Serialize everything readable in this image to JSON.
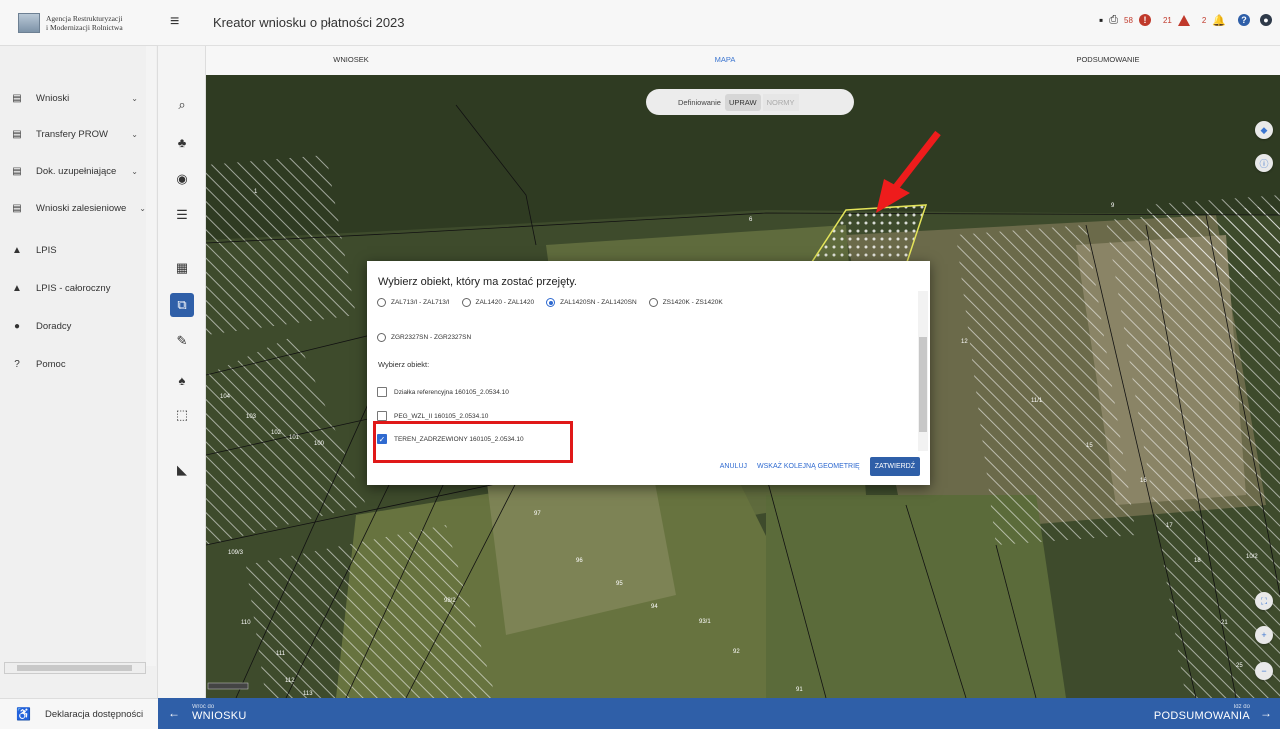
{
  "sidebar": {
    "logo_line1": "Agencja Restrukturyzacji",
    "logo_line2": "i Modernizacji Rolnictwa",
    "items": [
      {
        "label": "Wnioski",
        "icon": "document-icon",
        "chevron": "⌄"
      },
      {
        "label": "Transfery PROW",
        "icon": "document-icon",
        "chevron": "⌄"
      },
      {
        "label": "Dok. uzupełniające",
        "icon": "document-icon",
        "chevron": "⌄"
      },
      {
        "label": "Wnioski zalesieniowe",
        "icon": "document-icon",
        "chevron": "⌄"
      },
      {
        "label": "LPIS",
        "icon": "mountain-icon",
        "chevron": ""
      },
      {
        "label": "LPIS - całoroczny",
        "icon": "mountain-icon",
        "chevron": ""
      },
      {
        "label": "Doradcy",
        "icon": "person-icon",
        "chevron": ""
      },
      {
        "label": "Pomoc",
        "icon": "help-icon",
        "chevron": ""
      }
    ],
    "footer_label": "Deklaracja dostępności"
  },
  "header": {
    "title": "Kreator wniosku o płatności 2023",
    "error_count": "58",
    "warning_count": "21",
    "notification_count": "2"
  },
  "tabs": [
    {
      "label": "WNIOSEK",
      "active": false
    },
    {
      "label": "MAPA",
      "active": true
    },
    {
      "label": "PODSUMOWANIE",
      "active": false
    }
  ],
  "map": {
    "segment_label": "Definiowanie",
    "segment_active": "UPRAW",
    "segment_inactive": "NORMY",
    "parcel_labels": [
      "1",
      "6",
      "9",
      "12",
      "15",
      "16",
      "17",
      "18",
      "21",
      "25",
      "91",
      "92",
      "93/1",
      "94",
      "95",
      "96",
      "97",
      "98/2",
      "100",
      "101",
      "102",
      "103",
      "104",
      "109/3",
      "110",
      "111",
      "112",
      "113",
      "11/1",
      "10/2"
    ]
  },
  "dialog": {
    "title": "Wybierz obiekt, który ma zostać przejęty.",
    "radio_options": [
      {
        "label": "ZAL713/I - ZAL713/I",
        "selected": false
      },
      {
        "label": "ZAL1420 - ZAL1420",
        "selected": false
      },
      {
        "label": "ZAL1420SN - ZAL1420SN",
        "selected": true
      },
      {
        "label": "ZS1420K - ZS1420K",
        "selected": false
      },
      {
        "label": "ZGR2327SN - ZGR2327SN",
        "selected": false
      }
    ],
    "object_label": "Wybierz obiekt:",
    "objects": [
      {
        "label": "Działka referencyjna 160105_2.0534.10",
        "checked": false
      },
      {
        "label": "PEG_WZL_II 160105_2.0534.10",
        "checked": false
      },
      {
        "label": "TEREN_ZADRZEWIONY 160105_2.0534.10",
        "checked": true
      }
    ],
    "cancel_label": "ANULUJ",
    "next_label": "WSKAŻ KOLEJNĄ GEOMETRIĘ",
    "confirm_label": "ZATWIERDŹ"
  },
  "bottom": {
    "back_small": "Wróć do",
    "back_big": "WNIOSKU",
    "fwd_small": "Idź do",
    "fwd_big": "PODSUMOWANIA"
  },
  "colors": {
    "accent": "#2f5fa8",
    "highlight": "#e01818",
    "error": "#c0392b"
  }
}
